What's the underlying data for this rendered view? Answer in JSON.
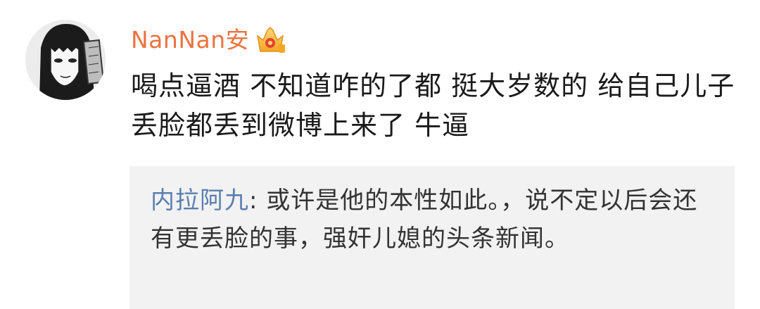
{
  "comment": {
    "username": "NanNan安",
    "badge_icon": "vip-crown-icon",
    "text": "喝点逼酒 不知道咋的了都 挺大岁数的 给自己儿子丢脸都丢到微博上来了 牛逼"
  },
  "reply": {
    "username": "内拉阿九",
    "separator": ": ",
    "text": "或许是他的本性如此。，说不定以后会还有更丢脸的事，强奸儿媳的头条新闻。"
  },
  "colors": {
    "username": "#eb7340",
    "reply_username": "#5a7fb0",
    "reply_background": "#f2f2f2",
    "text": "#1a1a1a"
  }
}
